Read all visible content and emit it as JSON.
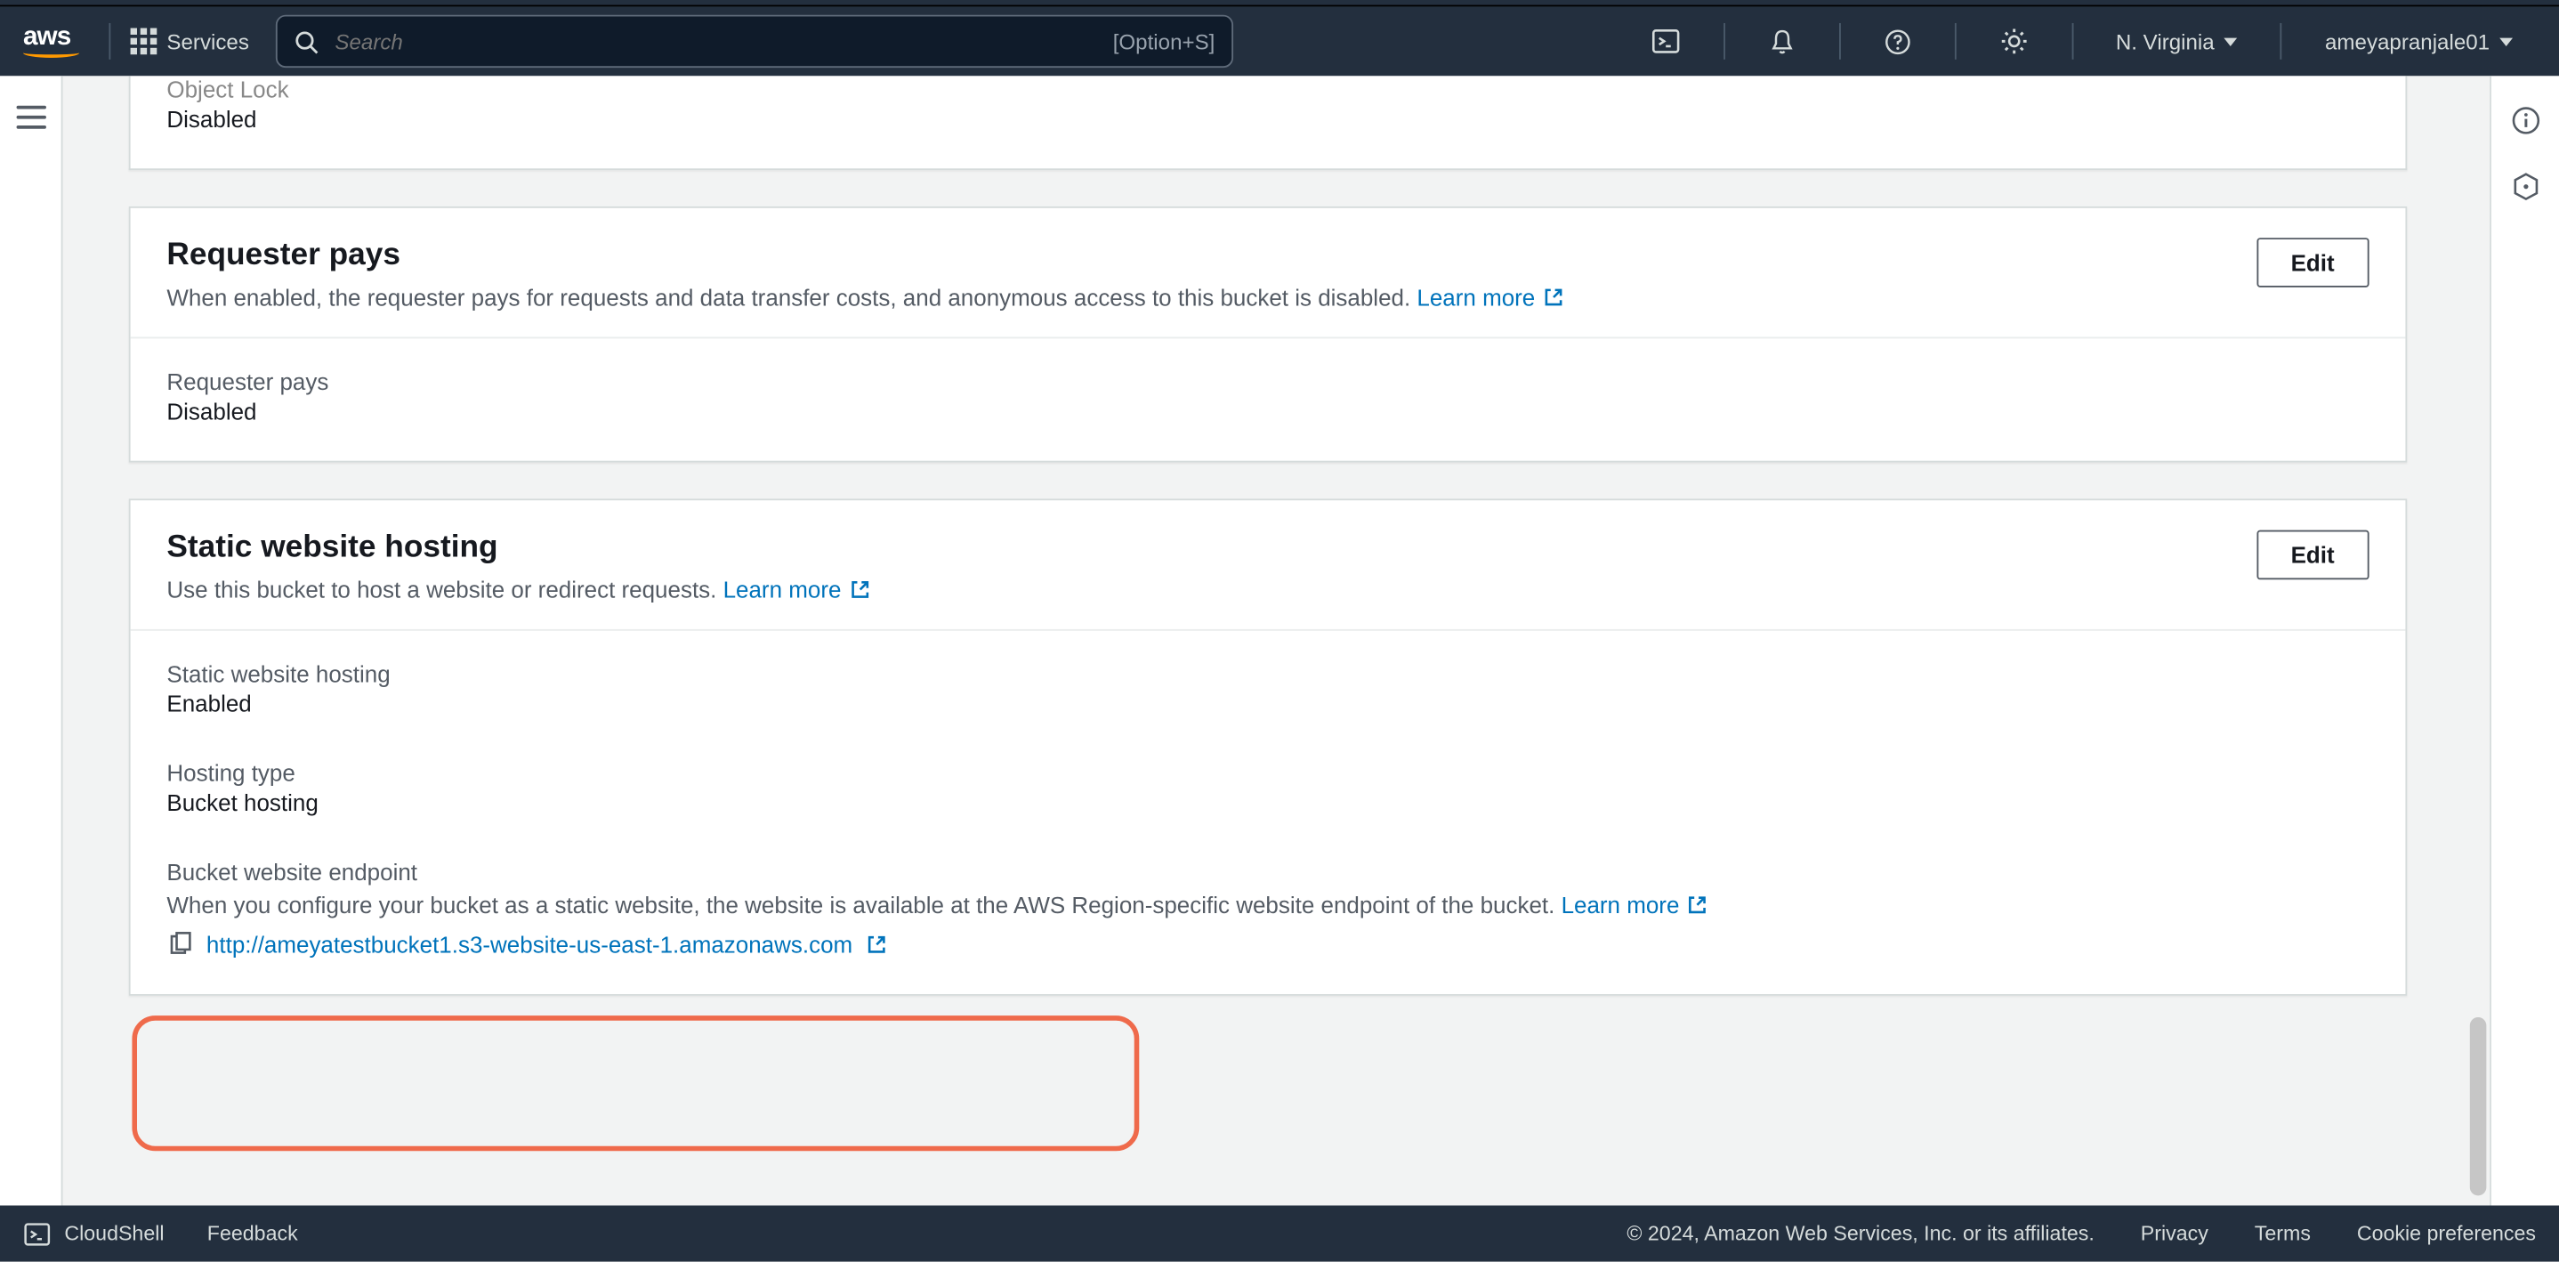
{
  "header": {
    "logo_text": "aws",
    "services_label": "Services",
    "search_placeholder": "Search",
    "search_hint": "[Option+S]",
    "region": "N. Virginia",
    "account": "ameyapranjale01"
  },
  "panels": {
    "object_lock": {
      "label": "Object Lock",
      "value": "Disabled"
    },
    "requester_pays": {
      "title": "Requester pays",
      "desc": "When enabled, the requester pays for requests and data transfer costs, and anonymous access to this bucket is disabled. ",
      "learn_more": "Learn more",
      "edit": "Edit",
      "field_label": "Requester pays",
      "field_value": "Disabled"
    },
    "static_hosting": {
      "title": "Static website hosting",
      "desc": "Use this bucket to host a website or redirect requests. ",
      "learn_more": "Learn more",
      "edit": "Edit",
      "f1_label": "Static website hosting",
      "f1_value": "Enabled",
      "f2_label": "Hosting type",
      "f2_value": "Bucket hosting",
      "f3_label": "Bucket website endpoint",
      "f3_desc": "When you configure your bucket as a static website, the website is available at the AWS Region-specific website endpoint of the bucket. ",
      "f3_learn_more": "Learn more",
      "f3_url": "http://ameyatestbucket1.s3-website-us-east-1.amazonaws.com"
    }
  },
  "footer": {
    "cloudshell": "CloudShell",
    "feedback": "Feedback",
    "copyright": "© 2024, Amazon Web Services, Inc. or its affiliates.",
    "privacy": "Privacy",
    "terms": "Terms",
    "cookie": "Cookie preferences"
  }
}
